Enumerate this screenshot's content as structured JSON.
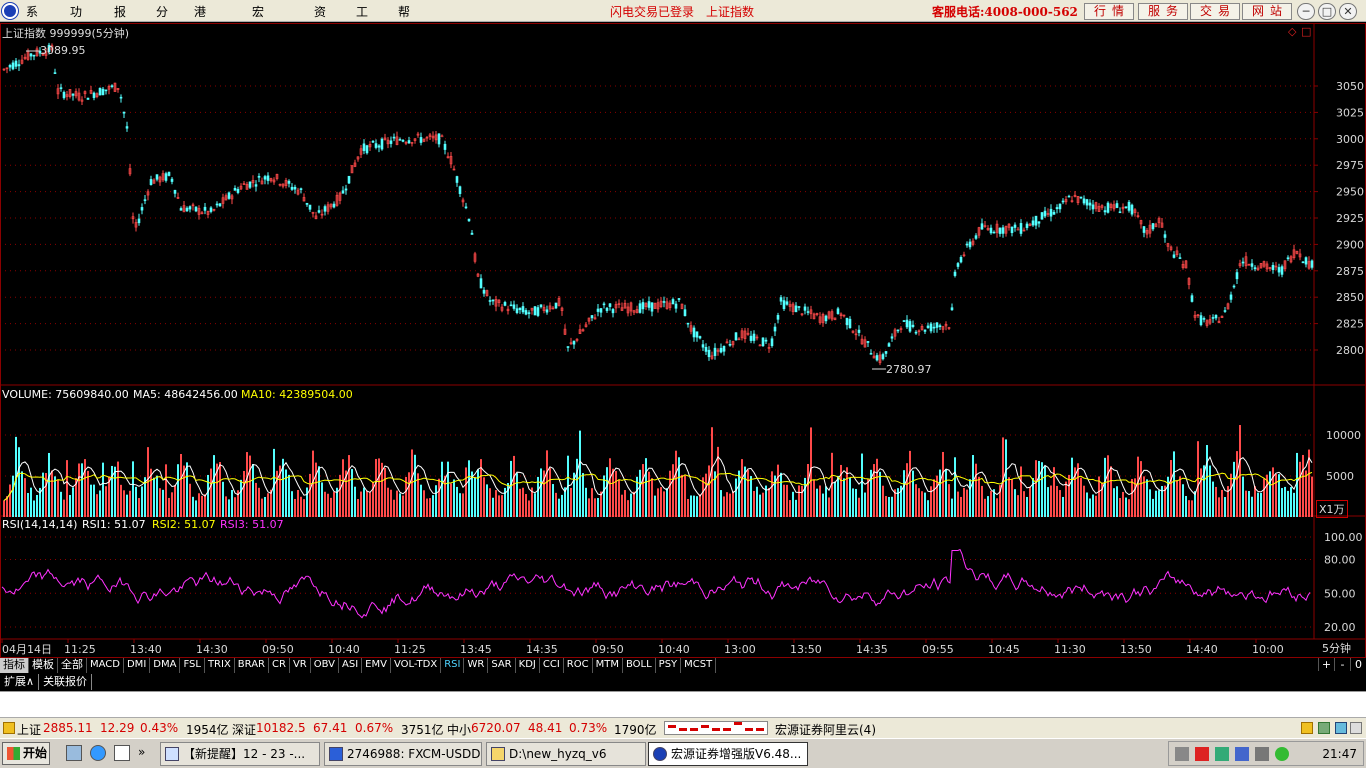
{
  "menubar": {
    "items": [
      "系统",
      "功能",
      "报价",
      "分析",
      "港股期货",
      "宏源特色",
      "资讯",
      "工具",
      "帮助"
    ],
    "notice_login": "闪电交易已登录",
    "notice_index": "上证指数",
    "hotline": "客服电话:4008-000-562",
    "buttons": [
      "行情",
      "服务",
      "交易",
      "网站"
    ],
    "window_controls": [
      "─",
      "□",
      "✕",
      "⊗"
    ]
  },
  "price_panel": {
    "title": "上证指数 999999(5分钟)",
    "high_label": "3089.95",
    "low_label": "2780.97",
    "y_ticks": [
      3050,
      3025,
      3000,
      2975,
      2950,
      2925,
      2900,
      2875,
      2850,
      2825,
      2800
    ],
    "corner_icons": [
      "◇",
      "□"
    ]
  },
  "volume_panel": {
    "label_volume": "VOLUME: 75609840.00",
    "label_ma5": "MA5: 48642456.00",
    "label_ma10": "MA10: 42389504.00",
    "y_ticks": [
      10000,
      5000
    ],
    "unit": "X1万"
  },
  "rsi_panel": {
    "label_name": "RSI(14,14,14)",
    "label_rsi1": "RSI1: 51.07",
    "label_rsi2": "RSI2: 51.07",
    "label_rsi3": "RSI3: 51.07",
    "y_ticks": [
      "100.00",
      "80.00",
      "50.00",
      "20.00"
    ]
  },
  "time_axis": {
    "labels": [
      "04月14日",
      "11:25",
      "13:40",
      "14:30",
      "09:50",
      "10:40",
      "11:25",
      "13:45",
      "14:35",
      "09:50",
      "10:40",
      "13:00",
      "13:50",
      "14:35",
      "09:55",
      "10:45",
      "11:30",
      "13:50",
      "14:40",
      "10:00"
    ],
    "period": "5分钟"
  },
  "indicator_tabs": [
    "指标",
    "模板",
    "全部",
    "MACD",
    "DMI",
    "DMA",
    "FSL",
    "TRIX",
    "BRAR",
    "CR",
    "VR",
    "OBV",
    "ASI",
    "EMV",
    "VOL-TDX",
    "RSI",
    "WR",
    "SAR",
    "KDJ",
    "CCI",
    "ROC",
    "MTM",
    "BOLL",
    "PSY",
    "MCST"
  ],
  "indicator_right_buttons": [
    "+",
    "-",
    "0"
  ],
  "ext_tabs": [
    "扩展∧",
    "关联报价"
  ],
  "ticker": {
    "sh_name": "上证",
    "sh_price": "2885.11",
    "sh_change": "12.29",
    "sh_pct": "0.43%",
    "sh_amount": "1954亿",
    "sz_name": "深证",
    "sz_price": "10182.5",
    "sz_change": "67.41",
    "sz_pct": "0.67%",
    "sz_amount": "3751亿",
    "zx_name": "中小",
    "zx_price": "6720.07",
    "zx_change": "48.41",
    "zx_pct": "0.73%",
    "zx_amount": "1790亿",
    "server": "宏源证券阿里云(4)"
  },
  "taskbar": {
    "start": "开始",
    "tasks": [
      "【新提醒】12 - 23 -...",
      "2746988: FXCM-USDDe...",
      "D:\\new_hyzq_v6",
      "宏源证券增强版V6.48..."
    ],
    "clock": "21:47"
  },
  "colors": {
    "up": "#ff4a4a",
    "down": "#54ffff",
    "grid": "#8b0000",
    "ma5": "#ffffff",
    "ma10": "#ffff00",
    "rsi": "#ff33ff"
  }
}
